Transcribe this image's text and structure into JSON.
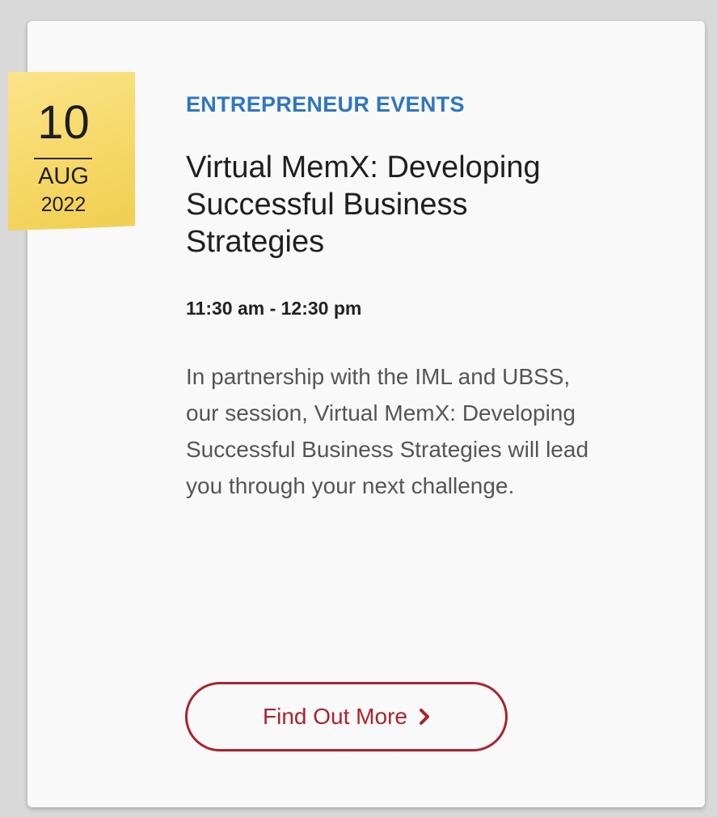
{
  "date": {
    "day": "10",
    "month": "AUG",
    "year": "2022"
  },
  "event": {
    "category": "ENTREPRENEUR EVENTS",
    "title": "Virtual MemX: Developing Successful Business Strategies",
    "time": "11:30 am - 12:30 pm",
    "description": "In partnership with the IML and UBSS, our session, Virtual MemX: Developing Successful Business Strategies will lead you through your next challenge."
  },
  "cta": {
    "label": "Find Out More",
    "icon": "chevron-right-icon"
  },
  "colors": {
    "category": "#2f77c0",
    "accent": "#a8242f",
    "date_tag": "#f6d867",
    "card_background": "#f9f9f9"
  }
}
